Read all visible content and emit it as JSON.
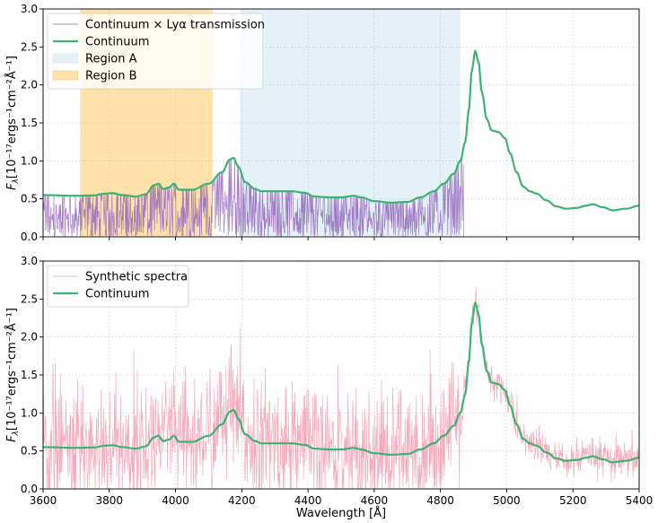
{
  "chart_data": [
    {
      "type": "line",
      "xlim": [
        3600,
        5400
      ],
      "ylim": [
        0,
        3.0
      ],
      "xticks": [
        3600,
        3800,
        4000,
        4200,
        4400,
        4600,
        4800,
        5000,
        5200,
        5400
      ],
      "yticks": [
        "0.0",
        "0.5",
        "1.0",
        "1.5",
        "2.0",
        "2.5",
        "3.0"
      ],
      "ylabel_main": "F",
      "ylabel_sub": "λ",
      "ylabel_units": "[10⁻¹⁷ergs⁻¹cm⁻²Å⁻¹]",
      "xlabel": "",
      "grid": true,
      "legend_position": "upper-left",
      "regions": [
        {
          "name": "Region A",
          "x0": 4195,
          "x1": 4860,
          "color": "#add8e6"
        },
        {
          "name": "Region B",
          "x0": 3712,
          "x1": 4112,
          "color": "#ffa500"
        }
      ],
      "series": [
        {
          "name": "Continuum × Lyα transmission",
          "color": "#9467bd",
          "x_end": 4870,
          "kind": "forest"
        },
        {
          "name": "Continuum",
          "color": "#3cb371",
          "kind": "continuum"
        }
      ],
      "legend": [
        "Continuum × Lyα transmission",
        "Continuum",
        "Region A",
        "Region B"
      ]
    },
    {
      "type": "line",
      "xlim": [
        3600,
        5400
      ],
      "ylim": [
        0,
        3.0
      ],
      "xticks": [
        3600,
        3800,
        4000,
        4200,
        4400,
        4600,
        4800,
        5000,
        5200,
        5400
      ],
      "yticks": [
        "0.0",
        "0.5",
        "1.0",
        "1.5",
        "2.0",
        "2.5",
        "3.0"
      ],
      "ylabel_main": "F",
      "ylabel_sub": "λ",
      "ylabel_units": "[10⁻¹⁷ergs⁻¹cm⁻²Å⁻¹]",
      "xlabel": "Wavelength [Å]",
      "grid": true,
      "legend_position": "upper-left",
      "series": [
        {
          "name": "Synthetic spectra",
          "color": "#f4a6b8",
          "kind": "noisy"
        },
        {
          "name": "Continuum",
          "color": "#3cb371",
          "kind": "continuum"
        }
      ],
      "legend": [
        "Synthetic spectra",
        "Continuum"
      ]
    }
  ],
  "continuum_points": [
    [
      3600,
      0.55
    ],
    [
      3700,
      0.54
    ],
    [
      3750,
      0.545
    ],
    [
      3790,
      0.57
    ],
    [
      3810,
      0.575
    ],
    [
      3840,
      0.55
    ],
    [
      3880,
      0.53
    ],
    [
      3910,
      0.56
    ],
    [
      3935,
      0.68
    ],
    [
      3948,
      0.7
    ],
    [
      3963,
      0.63
    ],
    [
      3980,
      0.65
    ],
    [
      3995,
      0.7
    ],
    [
      4010,
      0.62
    ],
    [
      4050,
      0.62
    ],
    [
      4100,
      0.7
    ],
    [
      4140,
      0.85
    ],
    [
      4165,
      1.02
    ],
    [
      4175,
      1.04
    ],
    [
      4190,
      0.92
    ],
    [
      4210,
      0.72
    ],
    [
      4240,
      0.63
    ],
    [
      4260,
      0.6
    ],
    [
      4300,
      0.6
    ],
    [
      4350,
      0.6
    ],
    [
      4390,
      0.58
    ],
    [
      4420,
      0.53
    ],
    [
      4460,
      0.52
    ],
    [
      4500,
      0.52
    ],
    [
      4540,
      0.54
    ],
    [
      4560,
      0.52
    ],
    [
      4600,
      0.47
    ],
    [
      4650,
      0.45
    ],
    [
      4700,
      0.46
    ],
    [
      4740,
      0.52
    ],
    [
      4780,
      0.6
    ],
    [
      4810,
      0.7
    ],
    [
      4840,
      0.83
    ],
    [
      4860,
      1.0
    ],
    [
      4875,
      1.25
    ],
    [
      4885,
      1.65
    ],
    [
      4895,
      2.2
    ],
    [
      4905,
      2.45
    ],
    [
      4915,
      2.3
    ],
    [
      4925,
      1.9
    ],
    [
      4940,
      1.55
    ],
    [
      4955,
      1.4
    ],
    [
      4975,
      1.38
    ],
    [
      4995,
      1.3
    ],
    [
      5010,
      1.1
    ],
    [
      5030,
      0.85
    ],
    [
      5050,
      0.66
    ],
    [
      5070,
      0.6
    ],
    [
      5090,
      0.57
    ],
    [
      5120,
      0.48
    ],
    [
      5150,
      0.4
    ],
    [
      5180,
      0.37
    ],
    [
      5210,
      0.38
    ],
    [
      5240,
      0.41
    ],
    [
      5260,
      0.43
    ],
    [
      5290,
      0.39
    ],
    [
      5320,
      0.35
    ],
    [
      5360,
      0.37
    ],
    [
      5400,
      0.41
    ]
  ]
}
